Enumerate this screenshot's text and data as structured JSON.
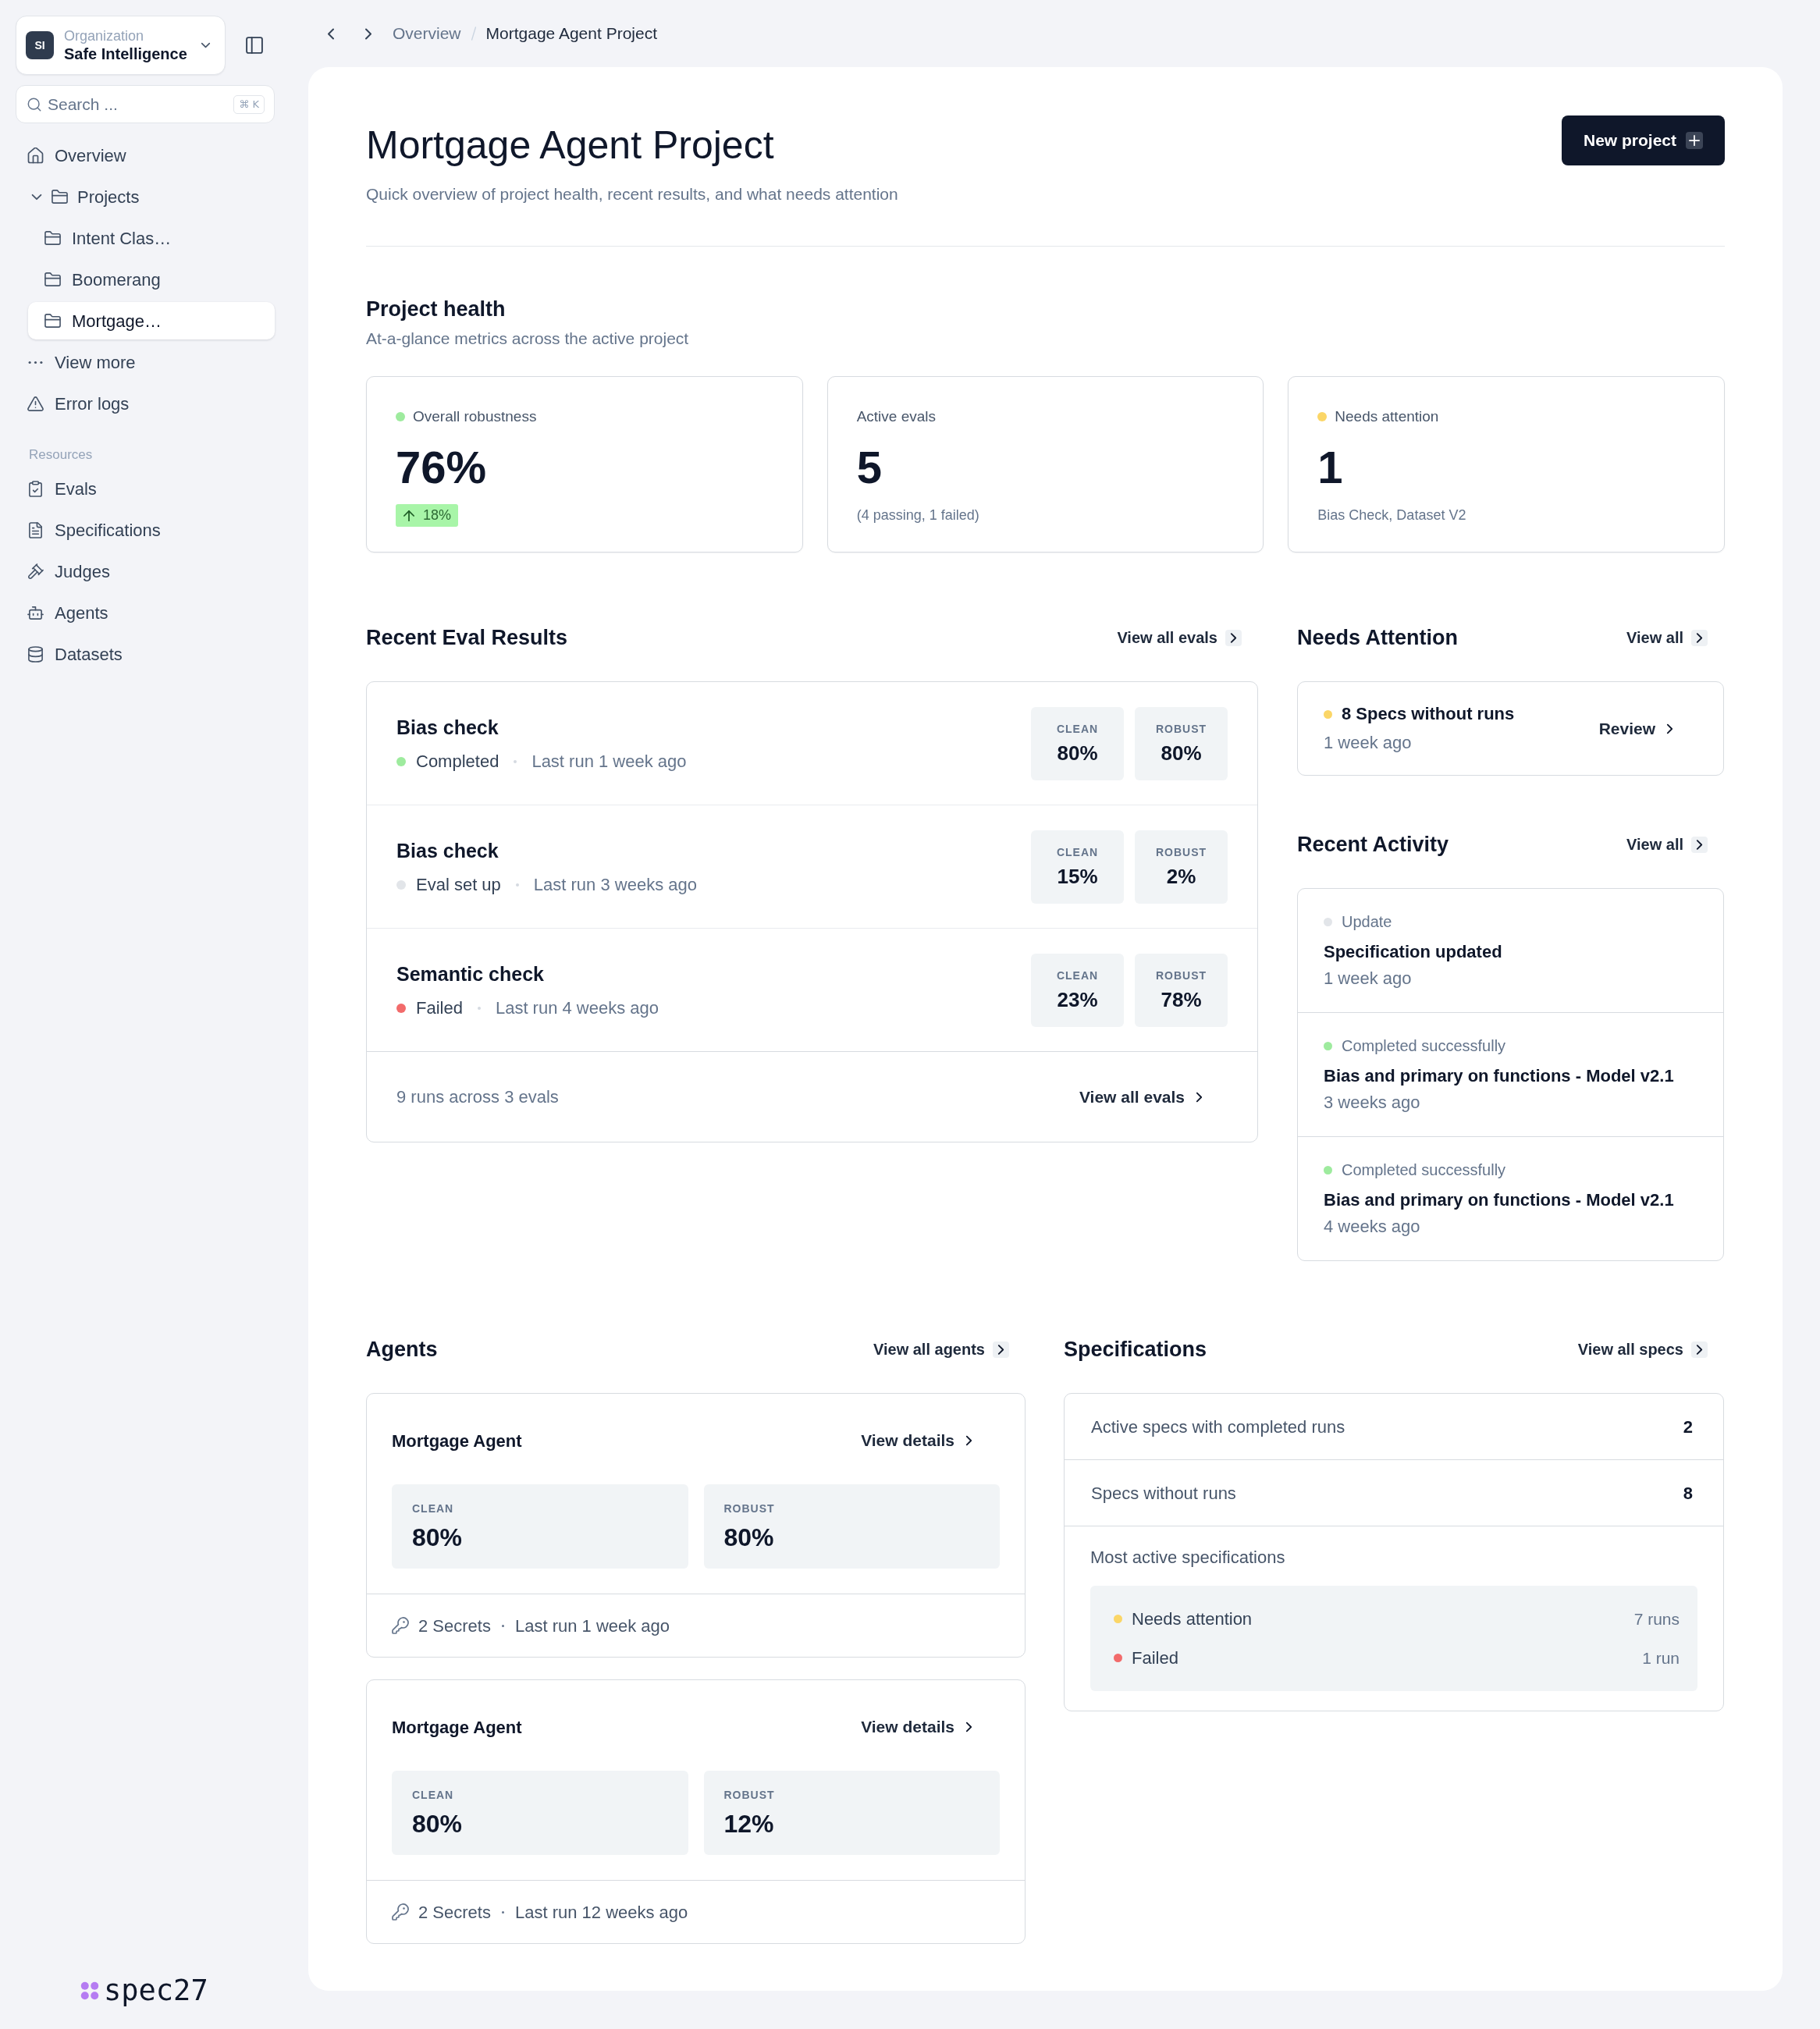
{
  "sidebar": {
    "organization": {
      "initials": "SI",
      "label": "Organization",
      "name": "Safe Intelligence"
    },
    "search": {
      "placeholder": "Search ...",
      "shortcut": "⌘ K"
    },
    "nav": [
      {
        "label": "Overview",
        "selected": false
      },
      {
        "label": "Projects",
        "selected": false,
        "expanded": true,
        "children": [
          {
            "label": "Intent Clas…",
            "selected": false
          },
          {
            "label": "Boomerang",
            "selected": false
          },
          {
            "label": "Mortgage…",
            "selected": true
          }
        ]
      },
      {
        "label": "View more",
        "selected": false
      },
      {
        "label": "Error logs",
        "selected": false
      }
    ],
    "resources": {
      "title": "Resources",
      "items": [
        {
          "label": "Evals",
          "selected": false
        },
        {
          "label": "Specifications",
          "selected": false
        },
        {
          "label": "Judges",
          "selected": false
        },
        {
          "label": "Agents",
          "selected": false
        },
        {
          "label": "Datasets",
          "selected": false
        }
      ]
    },
    "logo": "spec27"
  },
  "breadcrumb": [
    "Overview",
    "Mortgage Agent Project"
  ],
  "header": {
    "title": "Mortgage Agent Project",
    "subtitle": "Quick overview of project health, recent results, and what needs attention",
    "button": "New project"
  },
  "project_health": {
    "title": "Project health",
    "subtitle": "At-a-glance metrics across the active project",
    "cards": [
      {
        "label": "Overall robustness",
        "color": "#9eeb9e",
        "value": "76%",
        "change": "18%"
      },
      {
        "label": "Active evals",
        "value": "5",
        "note": "(4 passing, 1 failed)"
      },
      {
        "label": "Needs attention",
        "color": "#fbd667",
        "value": "1",
        "note": "Bias Check, Dataset V2"
      }
    ]
  },
  "recent_eval_results": {
    "title": "Recent Eval Results",
    "link": "View all evals",
    "rows": [
      {
        "name": "Bias check",
        "color": "#9eeb9e",
        "status": "Completed",
        "last_run": "Last run 1 week ago",
        "scores": [
          {
            "label": "CLEAN",
            "value": "80%"
          },
          {
            "label": "ROBUST",
            "value": "80%"
          }
        ]
      },
      {
        "name": "Bias check",
        "color": "#e2e5e9",
        "status": "Eval set up",
        "last_run": "Last run 3 weeks ago",
        "scores": [
          {
            "label": "CLEAN",
            "value": "15%"
          },
          {
            "label": "ROBUST",
            "value": "2%"
          }
        ]
      },
      {
        "name": "Semantic check",
        "color": "#f26b6b",
        "status": "Failed",
        "last_run": "Last run 4 weeks ago",
        "scores": [
          {
            "label": "CLEAN",
            "value": "23%"
          },
          {
            "label": "ROBUST",
            "value": "78%"
          }
        ]
      }
    ],
    "footer": {
      "summary": "9 runs across 3 evals",
      "link": "View all evals"
    }
  },
  "needs_attention": {
    "title": "Needs Attention",
    "link": "View all",
    "items": [
      {
        "color": "#fbd667",
        "title": "8 Specs without runs",
        "time": "1 week ago",
        "action": "Review"
      }
    ]
  },
  "recent_activity": {
    "title": "Recent Activity",
    "link": "View all",
    "items": [
      {
        "color": "#e2e5e9",
        "type": "Update",
        "title": "Specification updated",
        "time": "1 week ago"
      },
      {
        "color": "#9eeb9e",
        "type": "Completed successfully",
        "title": "Bias and primary on functions - Model v2.1",
        "time": "3 weeks ago"
      },
      {
        "color": "#9eeb9e",
        "type": "Completed successfully",
        "title": "Bias and primary on functions - Model v2.1",
        "time": "4 weeks ago"
      }
    ]
  },
  "agents": {
    "title": "Agents",
    "link": "View all agents",
    "cards": [
      {
        "name": "Mortgage Agent",
        "link": "View details",
        "scores": [
          {
            "label": "CLEAN",
            "value": "80%"
          },
          {
            "label": "ROBUST",
            "value": "80%"
          }
        ],
        "secrets": "2 Secrets",
        "last_run": "Last run 1 week ago"
      },
      {
        "name": "Mortgage Agent",
        "link": "View details",
        "scores": [
          {
            "label": "CLEAN",
            "value": "80%"
          },
          {
            "label": "ROBUST",
            "value": "12%"
          }
        ],
        "secrets": "2 Secrets",
        "last_run": "Last run 12 weeks ago"
      }
    ]
  },
  "specifications": {
    "title": "Specifications",
    "link": "View all specs",
    "stats": [
      {
        "label": "Active specs with completed runs",
        "value": "2"
      },
      {
        "label": "Specs without runs",
        "value": "8"
      }
    ],
    "most_active": {
      "title": "Most active specifications",
      "items": [
        {
          "color": "#fbd667",
          "label": "Needs attention",
          "count": "7 runs"
        },
        {
          "color": "#f26b6b",
          "label": "Failed",
          "count": "1 run"
        }
      ]
    }
  }
}
